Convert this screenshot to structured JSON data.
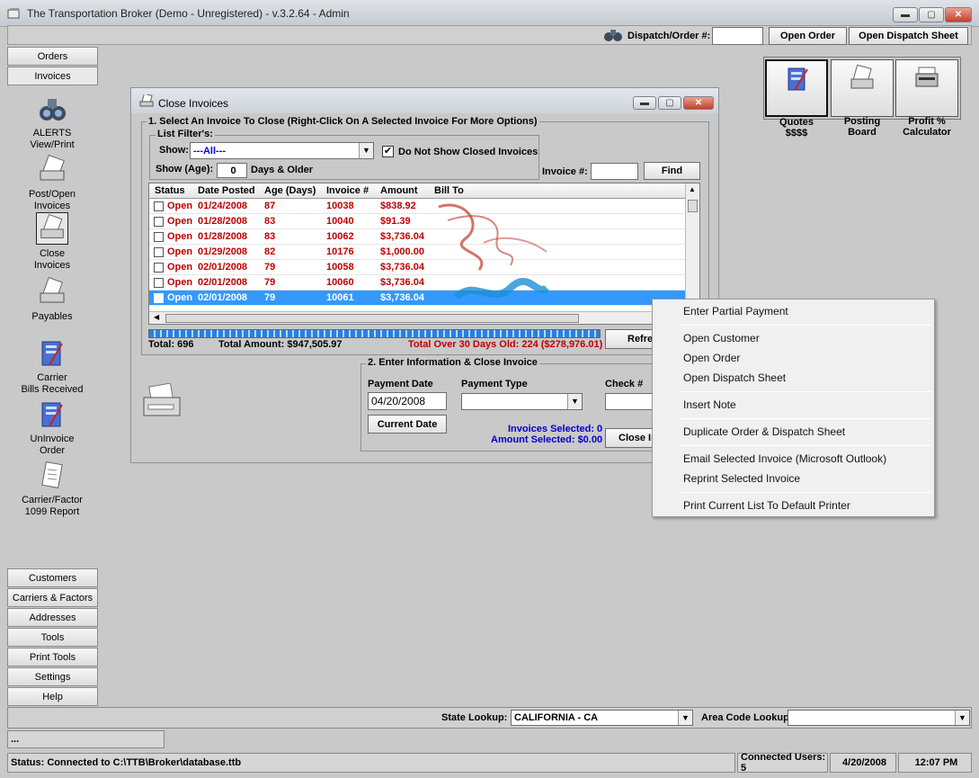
{
  "window": {
    "title": "The Transportation Broker (Demo - Unregistered) - v.3.2.64 - Admin",
    "minimize": "▬",
    "maximize": "▢",
    "close": "✕"
  },
  "toolbar": {
    "dispatch_label": "Dispatch/Order #:",
    "dispatch_value": "",
    "open_order": "Open Order",
    "open_dispatch": "Open Dispatch Sheet"
  },
  "nav_top": [
    {
      "label": "Orders"
    },
    {
      "label": "Invoices"
    }
  ],
  "side_items": [
    {
      "label": "ALERTS\nView/Print",
      "icon": "binoculars-icon"
    },
    {
      "label": "Post/Open\nInvoices",
      "icon": "invoice-post-icon"
    },
    {
      "label": "Close\nInvoices",
      "icon": "invoice-close-icon"
    },
    {
      "label": "Payables",
      "icon": "payables-icon"
    },
    {
      "label": "Carrier\nBills Received",
      "icon": "carrier-bills-icon"
    },
    {
      "label": "UnInvoice\nOrder",
      "icon": "uninvoice-icon"
    },
    {
      "label": "Carrier/Factor\n1099 Report",
      "icon": "report-icon"
    }
  ],
  "nav_bottom": [
    {
      "label": "Customers"
    },
    {
      "label": "Carriers & Factors"
    },
    {
      "label": "Addresses"
    },
    {
      "label": "Tools"
    },
    {
      "label": "Print Tools"
    },
    {
      "label": "Settings"
    },
    {
      "label": "Help"
    }
  ],
  "quick": {
    "quotes": "Quotes\n$$$$",
    "posting": "Posting\nBoard",
    "profit": "Profit %\nCalculator"
  },
  "dialog": {
    "title": "Close Invoices",
    "section1": "1. Select An Invoice To Close (Right-Click On A Selected Invoice For More Options)",
    "filters_label": "List Filter's:",
    "show_label": "Show:",
    "show_value": "---All---",
    "do_not_show_closed": "Do Not Show Closed Invoices",
    "do_not_show_closed_checked": "✔",
    "age_label": "Show (Age):",
    "age_value": "0",
    "age_suffix": "Days & Older",
    "invoice_label": "Invoice #:",
    "invoice_value": "",
    "find": "Find",
    "columns": [
      "Status",
      "Date Posted",
      "Age (Days)",
      "Invoice #",
      "Amount",
      "Bill To"
    ],
    "rows": [
      {
        "status": "Open",
        "date": "01/24/2008",
        "age": "87",
        "invoice": "10038",
        "amount": "$838.92",
        "selected": false
      },
      {
        "status": "Open",
        "date": "01/28/2008",
        "age": "83",
        "invoice": "10040",
        "amount": "$91.39",
        "selected": false
      },
      {
        "status": "Open",
        "date": "01/28/2008",
        "age": "83",
        "invoice": "10062",
        "amount": "$3,736.04",
        "selected": false
      },
      {
        "status": "Open",
        "date": "01/29/2008",
        "age": "82",
        "invoice": "10176",
        "amount": "$1,000.00",
        "selected": false
      },
      {
        "status": "Open",
        "date": "02/01/2008",
        "age": "79",
        "invoice": "10058",
        "amount": "$3,736.04",
        "selected": false
      },
      {
        "status": "Open",
        "date": "02/01/2008",
        "age": "79",
        "invoice": "10060",
        "amount": "$3,736.04",
        "selected": false
      },
      {
        "status": "Open",
        "date": "02/01/2008",
        "age": "79",
        "invoice": "10061",
        "amount": "$3,736.04",
        "selected": true
      }
    ],
    "total": "Total: 696",
    "total_amount": "Total Amount: $947,505.97",
    "over30": "Total Over 30 Days Old: 224 ($278,976.01)",
    "refresh": "Refre",
    "section2": "2. Enter Information & Close Invoice",
    "payment_date_label": "Payment Date",
    "payment_date": "04/20/2008",
    "payment_type_label": "Payment Type",
    "payment_type": "",
    "check_label": "Check #",
    "check_value": "",
    "current_date": "Current Date",
    "invoices_selected": "Invoices Selected: 0",
    "amount_selected": "Amount Selected: $0.00",
    "close_invoice": "Close In"
  },
  "context_menu": [
    {
      "label": "Enter Partial Payment"
    },
    {
      "label": "Open Customer"
    },
    {
      "label": "Open Order"
    },
    {
      "label": "Open Dispatch Sheet"
    },
    {
      "label": "Insert Note"
    },
    {
      "label": "Duplicate Order & Dispatch Sheet"
    },
    {
      "label": "Email Selected Invoice (Microsoft Outlook)"
    },
    {
      "label": "Reprint Selected Invoice"
    },
    {
      "label": "Print Current List To Default Printer"
    }
  ],
  "bottom": {
    "state_label": "State Lookup:",
    "state_value": "CALIFORNIA - CA",
    "area_label": "Area Code Lookup:",
    "area_value": "",
    "ellipsis": "...",
    "status": "Status: Connected to C:\\TTB\\Broker\\database.ttb",
    "users": "Connected Users: 5",
    "date": "4/20/2008",
    "time": "12:07 PM"
  },
  "colors": {
    "open_red": "#c00000",
    "selection_blue": "#3399ff",
    "info_blue": "#0000cc"
  }
}
